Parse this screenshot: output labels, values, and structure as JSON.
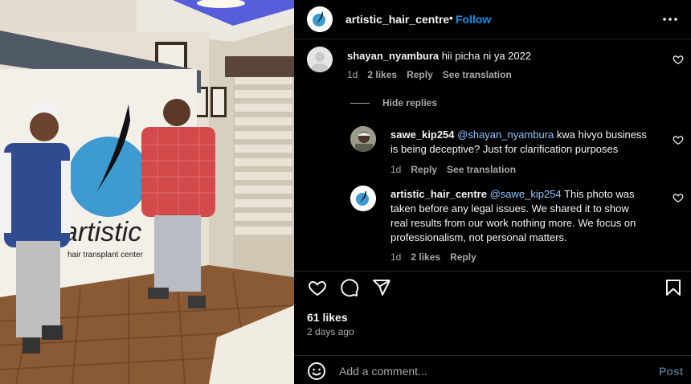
{
  "colors": {
    "background": "#000000",
    "text_primary": "#f5f5f5",
    "text_secondary": "#a8a8a8",
    "accent": "#0095f6",
    "mention": "#8ec5ff",
    "post_disabled": "#4a6b85"
  },
  "photo": {
    "sign_brand": "artistic",
    "sign_tagline": "hair transplant center"
  },
  "post": {
    "username": "artistic_hair_centre",
    "separator": "•",
    "follow_label": "Follow",
    "more_icon": "more-horizontal-icon"
  },
  "comments": [
    {
      "username": "shayan_nyambura",
      "text": "hii picha ni ya 2022",
      "time": "1d",
      "likes": "2 likes",
      "reply": "Reply",
      "translate": "See translation"
    }
  ],
  "hide_replies": "Hide replies",
  "replies": [
    {
      "username": "sawe_kip254",
      "mention": "@shayan_nyambura",
      "text_line1": "kwa hivyo business",
      "text_line2": "is being deceptive? Just for clarification purposes",
      "time": "1d",
      "reply": "Reply",
      "translate": "See translation"
    },
    {
      "username": "artistic_hair_centre",
      "mention": "@sawe_kip254",
      "text_line1": "This photo was",
      "text_line2": "taken before any legal issues. We shared it to show",
      "text_line3": "real results from our work nothing more. We focus on",
      "text_line4": "professionalism, not personal matters.",
      "time": "1d",
      "likes": "2 likes",
      "reply": "Reply"
    }
  ],
  "actions": {
    "like_icon": "heart-icon",
    "comment_icon": "comment-icon",
    "share_icon": "share-icon",
    "save_icon": "bookmark-icon"
  },
  "likes_count": "61 likes",
  "posted_time": "2 days ago",
  "composer": {
    "emoji_icon": "emoji-icon",
    "placeholder": "Add a comment...",
    "post_label": "Post"
  }
}
